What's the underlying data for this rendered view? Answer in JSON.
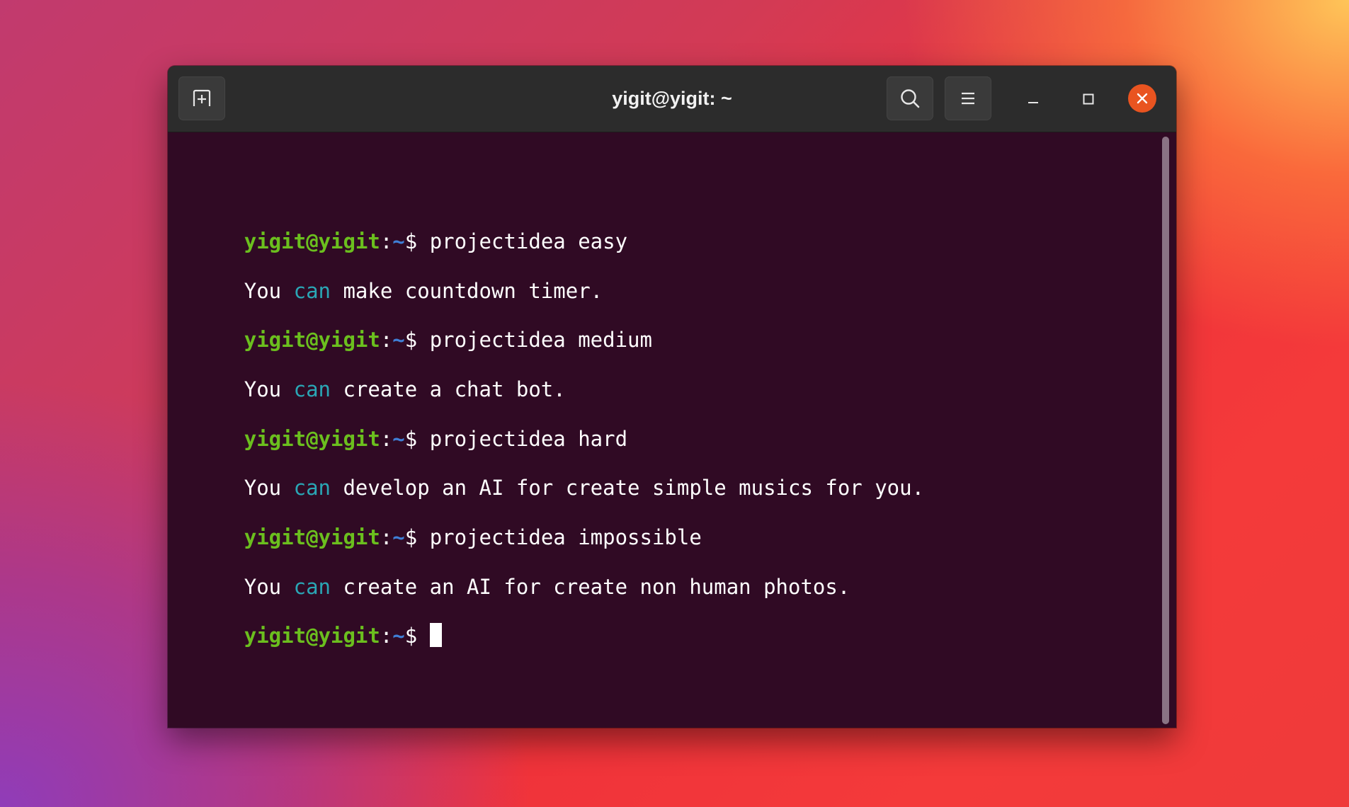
{
  "window": {
    "title": "yigit@yigit: ~"
  },
  "toolbar": {
    "new_tab_icon": "new-tab-icon",
    "search_icon": "search-icon",
    "menu_icon": "hamburger-menu-icon",
    "minimize_icon": "minimize-icon",
    "maximize_icon": "maximize-icon",
    "close_icon": "close-icon"
  },
  "prompt": {
    "user_host": "yigit@yigit",
    "colon": ":",
    "path": "~",
    "symbol": "$ "
  },
  "lines": [
    {
      "type": "command",
      "text": "projectidea easy"
    },
    {
      "type": "output",
      "pre": "You ",
      "keyword": "can",
      "post": " make countdown timer."
    },
    {
      "type": "command",
      "text": "projectidea medium"
    },
    {
      "type": "output",
      "pre": "You ",
      "keyword": "can",
      "post": " create a chat bot."
    },
    {
      "type": "command",
      "text": "projectidea hard"
    },
    {
      "type": "output",
      "pre": "You ",
      "keyword": "can",
      "post": " develop an AI for create simple musics for you."
    },
    {
      "type": "command",
      "text": "projectidea impossible"
    },
    {
      "type": "output",
      "pre": "You ",
      "keyword": "can",
      "post": " create an AI for create non human photos."
    },
    {
      "type": "prompt",
      "text": ""
    }
  ],
  "colors": {
    "terminal_bg": "#300a24",
    "prompt_user": "#6bbf1e",
    "prompt_path": "#3f7fd6",
    "keyword": "#2aa6b5",
    "close_button": "#e95420"
  }
}
